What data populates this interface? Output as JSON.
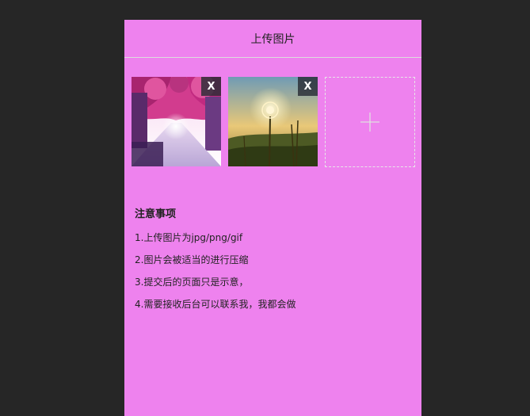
{
  "page": {
    "title": "上传图片"
  },
  "uploads": {
    "images": [
      {
        "alt": "street-with-pink-trees-photo",
        "remove_label": "X"
      },
      {
        "alt": "dandelion-sunset-photo",
        "remove_label": "X"
      }
    ],
    "add_icon": "plus-icon"
  },
  "notes": {
    "title": "注意事项",
    "items": [
      "1.上传图片为jpg/png/gif",
      "2.图片会被适当的进行压缩",
      "3.提交后的页面只是示意，",
      "4.需要接收后台可以联系我，我都会做"
    ]
  },
  "colors": {
    "background": "#262626",
    "panel": "#ee82ee",
    "divider": "#dcdcdc"
  }
}
